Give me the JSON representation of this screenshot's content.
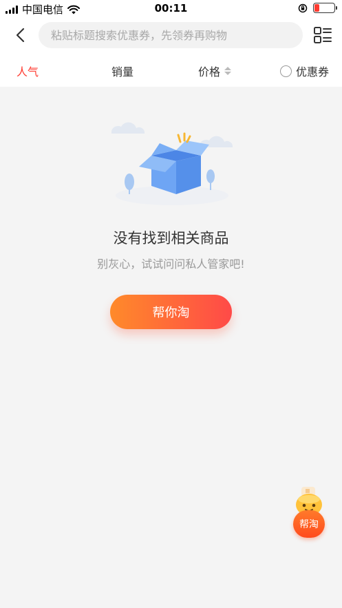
{
  "status": {
    "carrier": "中国电信",
    "time": "00:11"
  },
  "nav": {
    "search_placeholder": "粘贴标题搜索优惠券，先领券再购物"
  },
  "sort": {
    "popularity": "人气",
    "sales": "销量",
    "price": "价格",
    "coupon": "优惠券",
    "active": "popularity",
    "active_color": "#ff3b30"
  },
  "empty": {
    "title": "没有找到相关商品",
    "subtitle": "别灰心，试试问问私人管家吧!",
    "button_label": "帮你淘"
  },
  "float_help": {
    "label": "帮淘"
  },
  "colors": {
    "accent": "#ff3b30",
    "button_gradient_start": "#ff8a2a",
    "button_gradient_end": "#ff4a48",
    "background": "#f4f4f4"
  }
}
